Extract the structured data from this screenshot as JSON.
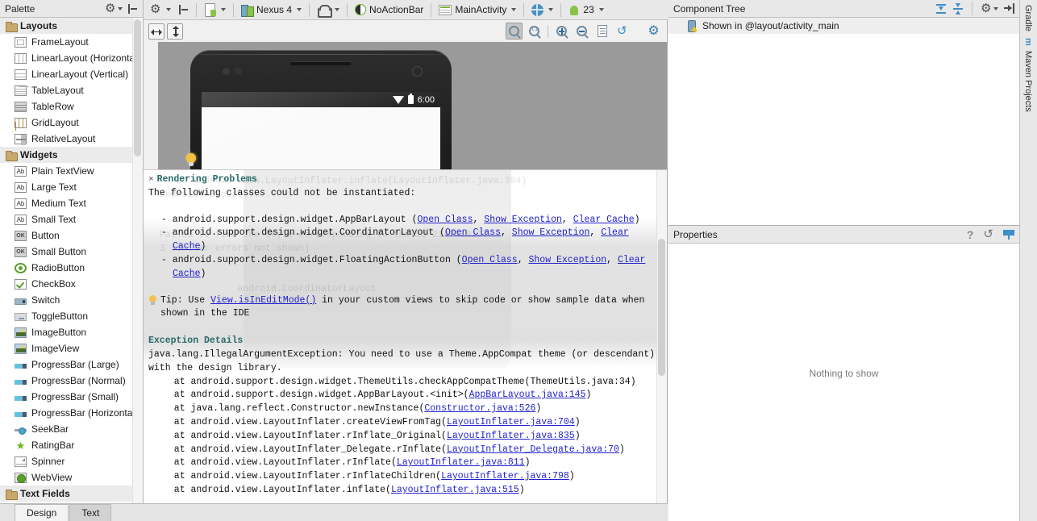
{
  "toolbar": {
    "settings_icon": "gear-icon",
    "collapse_icon": "collapse-all-icon",
    "file_label": "",
    "device_label": "Nexus 4",
    "orientation_label": "",
    "theme_label": "NoActionBar",
    "activity_label": "MainActivity",
    "locale_label": "",
    "api_label": "23"
  },
  "palette": {
    "title": "Palette",
    "groups": [
      {
        "name": "Layouts",
        "items": [
          {
            "label": "FrameLayout",
            "icon": "frame-layout-icon",
            "cls": "w-frame"
          },
          {
            "label": "LinearLayout (Horizontal)",
            "icon": "linear-layout-horizontal-icon",
            "cls": "w-linh"
          },
          {
            "label": "LinearLayout (Vertical)",
            "icon": "linear-layout-vertical-icon",
            "cls": "w-linv"
          },
          {
            "label": "TableLayout",
            "icon": "table-layout-icon",
            "cls": "w-tablel"
          },
          {
            "label": "TableRow",
            "icon": "table-row-icon",
            "cls": "w-tabler"
          },
          {
            "label": "GridLayout",
            "icon": "grid-layout-icon",
            "cls": "w-grid"
          },
          {
            "label": "RelativeLayout",
            "icon": "relative-layout-icon",
            "cls": "w-rel"
          }
        ]
      },
      {
        "name": "Widgets",
        "items": [
          {
            "label": "Plain TextView",
            "icon": "text-view-icon",
            "cls": "w-ab",
            "glyph": "Ab"
          },
          {
            "label": "Large Text",
            "icon": "large-text-icon",
            "cls": "w-ab",
            "glyph": "Ab"
          },
          {
            "label": "Medium Text",
            "icon": "medium-text-icon",
            "cls": "w-ab",
            "glyph": "Ab"
          },
          {
            "label": "Small Text",
            "icon": "small-text-icon",
            "cls": "w-ab",
            "glyph": "Ab"
          },
          {
            "label": "Button",
            "icon": "button-icon",
            "cls": "w-ok",
            "glyph": "OK"
          },
          {
            "label": "Small Button",
            "icon": "small-button-icon",
            "cls": "w-ok",
            "glyph": "OK"
          },
          {
            "label": "RadioButton",
            "icon": "radio-button-icon",
            "cls": "w-radio"
          },
          {
            "label": "CheckBox",
            "icon": "checkbox-icon",
            "cls": "w-check"
          },
          {
            "label": "Switch",
            "icon": "switch-icon",
            "cls": "w-switch"
          },
          {
            "label": "ToggleButton",
            "icon": "toggle-button-icon",
            "cls": "w-toggle"
          },
          {
            "label": "ImageButton",
            "icon": "image-button-icon",
            "cls": "w-imgbtn"
          },
          {
            "label": "ImageView",
            "icon": "image-view-icon",
            "cls": "w-imgview"
          },
          {
            "label": "ProgressBar (Large)",
            "icon": "progress-bar-icon",
            "cls": "w-prog"
          },
          {
            "label": "ProgressBar (Normal)",
            "icon": "progress-bar-icon",
            "cls": "w-prog"
          },
          {
            "label": "ProgressBar (Small)",
            "icon": "progress-bar-icon",
            "cls": "w-prog"
          },
          {
            "label": "ProgressBar (Horizontal)",
            "icon": "progress-bar-icon",
            "cls": "w-prog"
          },
          {
            "label": "SeekBar",
            "icon": "seek-bar-icon",
            "cls": "w-seek"
          },
          {
            "label": "RatingBar",
            "icon": "rating-bar-icon",
            "cls": "w-rating",
            "glyph": "★"
          },
          {
            "label": "Spinner",
            "icon": "spinner-icon",
            "cls": "w-spinner"
          },
          {
            "label": "WebView",
            "icon": "web-view-icon",
            "cls": "w-web"
          }
        ]
      },
      {
        "name": "Text Fields",
        "items": []
      }
    ]
  },
  "design": {
    "resize_horizontal": "resize-horizontal-button",
    "resize_vertical": "resize-vertical-button",
    "zoom_fit": "zoom-to-fit-button",
    "zoom_actual": "1:1",
    "zoom_in": "zoom-in-button",
    "zoom_out": "zoom-out-button",
    "doc": "document-button",
    "refresh": "refresh-button",
    "gear": "gear-button",
    "status_time": "6:00"
  },
  "render_error": {
    "title": "Rendering Problems",
    "close": "×",
    "intro": "The following classes could not be instantiated:",
    "classes": [
      {
        "name": "- android.support.design.widget.AppBarLayout",
        "links": [
          "Open Class",
          "Show Exception",
          "Clear Cache"
        ]
      },
      {
        "name": "- android.support.design.widget.CoordinatorLayout",
        "links": [
          "Open Class",
          "Show Exception",
          "Clear Cache"
        ]
      },
      {
        "name": "- android.support.design.widget.FloatingActionButton",
        "links": [
          "Open Class",
          "Show Exception",
          "Clear Cache"
        ]
      }
    ],
    "tip_prefix": "Tip: Use ",
    "tip_link": "View.isInEditMode()",
    "tip_suffix": " in your custom views to skip code or show sample data when shown in the IDE",
    "exception_heading": "Exception Details",
    "exception_message": "java.lang.IllegalArgumentException: You need to use a Theme.AppCompat theme (or descendant) with the design library.",
    "stack": [
      {
        "text": "  at android.support.design.widget.ThemeUtils.checkAppCompatTheme(ThemeUtils.java:34)",
        "link": null
      },
      {
        "text": "  at android.support.design.widget.AppBarLayout.<init>(",
        "link": "AppBarLayout.java:145",
        "tail": ")"
      },
      {
        "text": "  at java.lang.reflect.Constructor.newInstance(",
        "link": "Constructor.java:526",
        "tail": ")"
      },
      {
        "text": "  at android.view.LayoutInflater.createViewFromTag(",
        "link": "LayoutInflater.java:704",
        "tail": ")"
      },
      {
        "text": "  at android.view.LayoutInflater.rInflate_Original(",
        "link": "LayoutInflater.java:835",
        "tail": ")"
      },
      {
        "text": "  at android.view.LayoutInflater_Delegate.rInflate(",
        "link": "LayoutInflater_Delegate.java:70",
        "tail": ")"
      },
      {
        "text": "  at android.view.LayoutInflater.rInflate(",
        "link": "LayoutInflater.java:811",
        "tail": ")"
      },
      {
        "text": "  at android.view.LayoutInflater.rInflateChildren(",
        "link": "LayoutInflater.java:798",
        "tail": ")"
      },
      {
        "text": "  at android.view.LayoutInflater.inflate(",
        "link": "LayoutInflater.java:515",
        "tail": ")"
      }
    ],
    "ghost_text": "     at android.view.LayoutInflater.inflate(LayoutInflater.java:394)\n  android.support.v7...\n\n\n  Failed to find the style corresponding to the id 2147418197\n  3 similar errors not shown)\n\n\n                android.CoordinatorLayout"
  },
  "component_tree": {
    "title": "Component Tree",
    "expand_icon": "expand-all-icon",
    "collapse_icon": "collapse-all-icon",
    "settings_icon": "gear-icon",
    "hide_icon": "hide-panel-icon",
    "rows": [
      {
        "label": "Shown in @layout/activity_main",
        "icon": "device-warning-icon"
      }
    ]
  },
  "properties": {
    "title": "Properties",
    "help_icon": "help-icon",
    "restore_icon": "restore-default-icon",
    "filter_icon": "filter-icon",
    "empty_text": "Nothing to show"
  },
  "bottom_tabs": [
    {
      "label": "Design",
      "active": true
    },
    {
      "label": "Text",
      "active": false
    }
  ],
  "right_tabs": [
    {
      "label": "Gradle"
    },
    {
      "label": "Maven Projects"
    }
  ]
}
